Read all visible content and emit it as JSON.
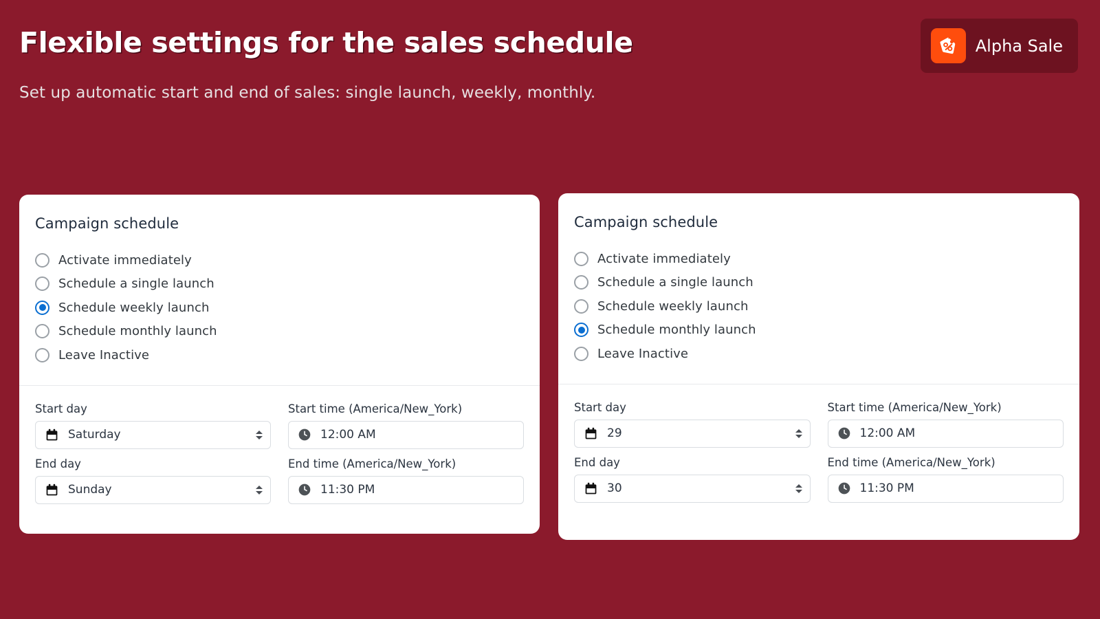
{
  "header": {
    "title": "Flexible settings for the sales schedule",
    "subtitle": "Set up automatic start and end of sales: single launch, weekly, monthly."
  },
  "brand": {
    "name": "Alpha Sale",
    "logo_icon": "price-tag-percent-icon",
    "logo_color": "#ff4d0d",
    "badge_color": "#6d1220"
  },
  "theme": {
    "background": "#8b1a2c",
    "card_background": "#ffffff",
    "accent": "#0a6ed1"
  },
  "cards": [
    {
      "heading": "Campaign schedule",
      "options": [
        {
          "label": "Activate immediately",
          "selected": false
        },
        {
          "label": "Schedule a single launch",
          "selected": false
        },
        {
          "label": "Schedule weekly launch",
          "selected": true
        },
        {
          "label": "Schedule monthly launch",
          "selected": false
        },
        {
          "label": "Leave Inactive",
          "selected": false
        }
      ],
      "fields": [
        {
          "label": "Start day",
          "value": "Saturday",
          "icon": "calendar-icon",
          "stepper": true
        },
        {
          "label": "Start time (America/New_York)",
          "value": "12:00 AM",
          "icon": "clock-icon",
          "stepper": false
        },
        {
          "label": "End day",
          "value": "Sunday",
          "icon": "calendar-icon",
          "stepper": true
        },
        {
          "label": "End time (America/New_York)",
          "value": "11:30 PM",
          "icon": "clock-icon",
          "stepper": false
        }
      ]
    },
    {
      "heading": "Campaign schedule",
      "options": [
        {
          "label": "Activate immediately",
          "selected": false
        },
        {
          "label": "Schedule a single launch",
          "selected": false
        },
        {
          "label": "Schedule weekly launch",
          "selected": false
        },
        {
          "label": "Schedule monthly launch",
          "selected": true
        },
        {
          "label": "Leave Inactive",
          "selected": false
        }
      ],
      "fields": [
        {
          "label": "Start day",
          "value": "29",
          "icon": "calendar-icon",
          "stepper": true
        },
        {
          "label": "Start time (America/New_York)",
          "value": "12:00 AM",
          "icon": "clock-icon",
          "stepper": false
        },
        {
          "label": "End day",
          "value": "30",
          "icon": "calendar-icon",
          "stepper": true
        },
        {
          "label": "End time (America/New_York)",
          "value": "11:30 PM",
          "icon": "clock-icon",
          "stepper": false
        }
      ]
    }
  ]
}
